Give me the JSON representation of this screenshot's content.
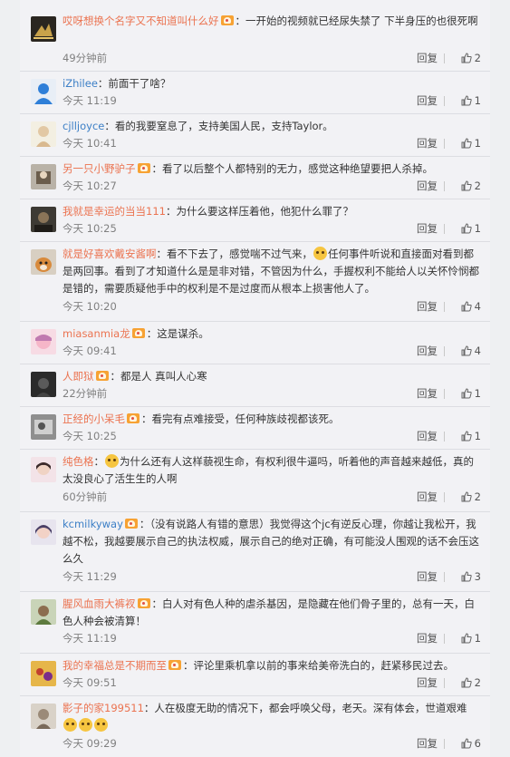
{
  "ui": {
    "reply_label": "回复"
  },
  "comments": [
    {
      "user": "哎呀想换个名字又不知道叫什么好",
      "text": "：一开始的视频就已经尿失禁了 下半身压的也很死啊",
      "time": "49分钟前",
      "likes": "2"
    },
    {
      "user": "iZhilee",
      "text": "：前面干了啥？",
      "time": "今天 11:19",
      "likes": "1"
    },
    {
      "user": "cjlljoyce",
      "text": "：看的我要窒息了，支持美国人民，支持Taylor。",
      "time": "今天 10:41",
      "likes": "1"
    },
    {
      "user": "另一只小野驴子",
      "text": "：看了以后整个人都特别的无力，感觉这种绝望要把人杀掉。",
      "time": "今天 10:27",
      "likes": "2"
    },
    {
      "user": "我就是幸运的当当111",
      "text": "：为什么要这样压着他，他犯什么罪了？",
      "time": "今天 10:25",
      "likes": "1"
    },
    {
      "user": "就是好喜欢戴安酱啊",
      "text_a": "：看不下去了，感觉喘不过气来，",
      "text_b": "任何事件听说和直接面对看到都是两回事。看到了才知道什么是是非对错，不管因为什么，手握权利不能给人以关怀怜悯都是错的，需要质疑他手中的权利是不是过度而从根本上损害他人了。",
      "time": "今天 10:20",
      "likes": "4"
    },
    {
      "user": "miasanmia龙",
      "text": "：这是谋杀。",
      "time": "今天 09:41",
      "likes": "4"
    },
    {
      "user": "人即狱",
      "text": "：都是人 真叫人心寒",
      "time": "22分钟前",
      "likes": "1"
    },
    {
      "user": "正经的小呆毛",
      "text": "：看完有点难接受，任何种族歧视都该死。",
      "time": "今天 10:25",
      "likes": "1"
    },
    {
      "user": "纯色格",
      "text": "为什么还有人这样藐视生命，有权利很牛逼吗，听着他的声音越来越低，真的太没良心了活生生的人啊",
      "time": "60分钟前",
      "likes": "2"
    },
    {
      "user": "kcmilkyway",
      "text": "：（没有说路人有错的意思）我觉得这个jc有逆反心理，你越让我松开，我越不松，我越要展示自己的执法权威，展示自己的绝对正确，有可能没人围观的话不会压这么久",
      "time": "今天 11:29",
      "likes": "3"
    },
    {
      "user": "腥风血雨大裤衩",
      "text": "：白人对有色人种的虐杀基因，是隐藏在他们骨子里的，总有一天，白色人种会被清算！",
      "time": "今天 11:19",
      "likes": "1"
    },
    {
      "user": "我的幸福总是不期而至",
      "text": "：评论里乘机拿以前的事来给美帝洗白的，赶紧移民过去。",
      "time": "今天 09:51",
      "likes": "2"
    },
    {
      "user": "影子的家199511",
      "text": "：人在极度无助的情况下，都会呼唤父母，老天。深有体会，世道艰难",
      "time": "今天 09:29",
      "likes": "6"
    }
  ]
}
